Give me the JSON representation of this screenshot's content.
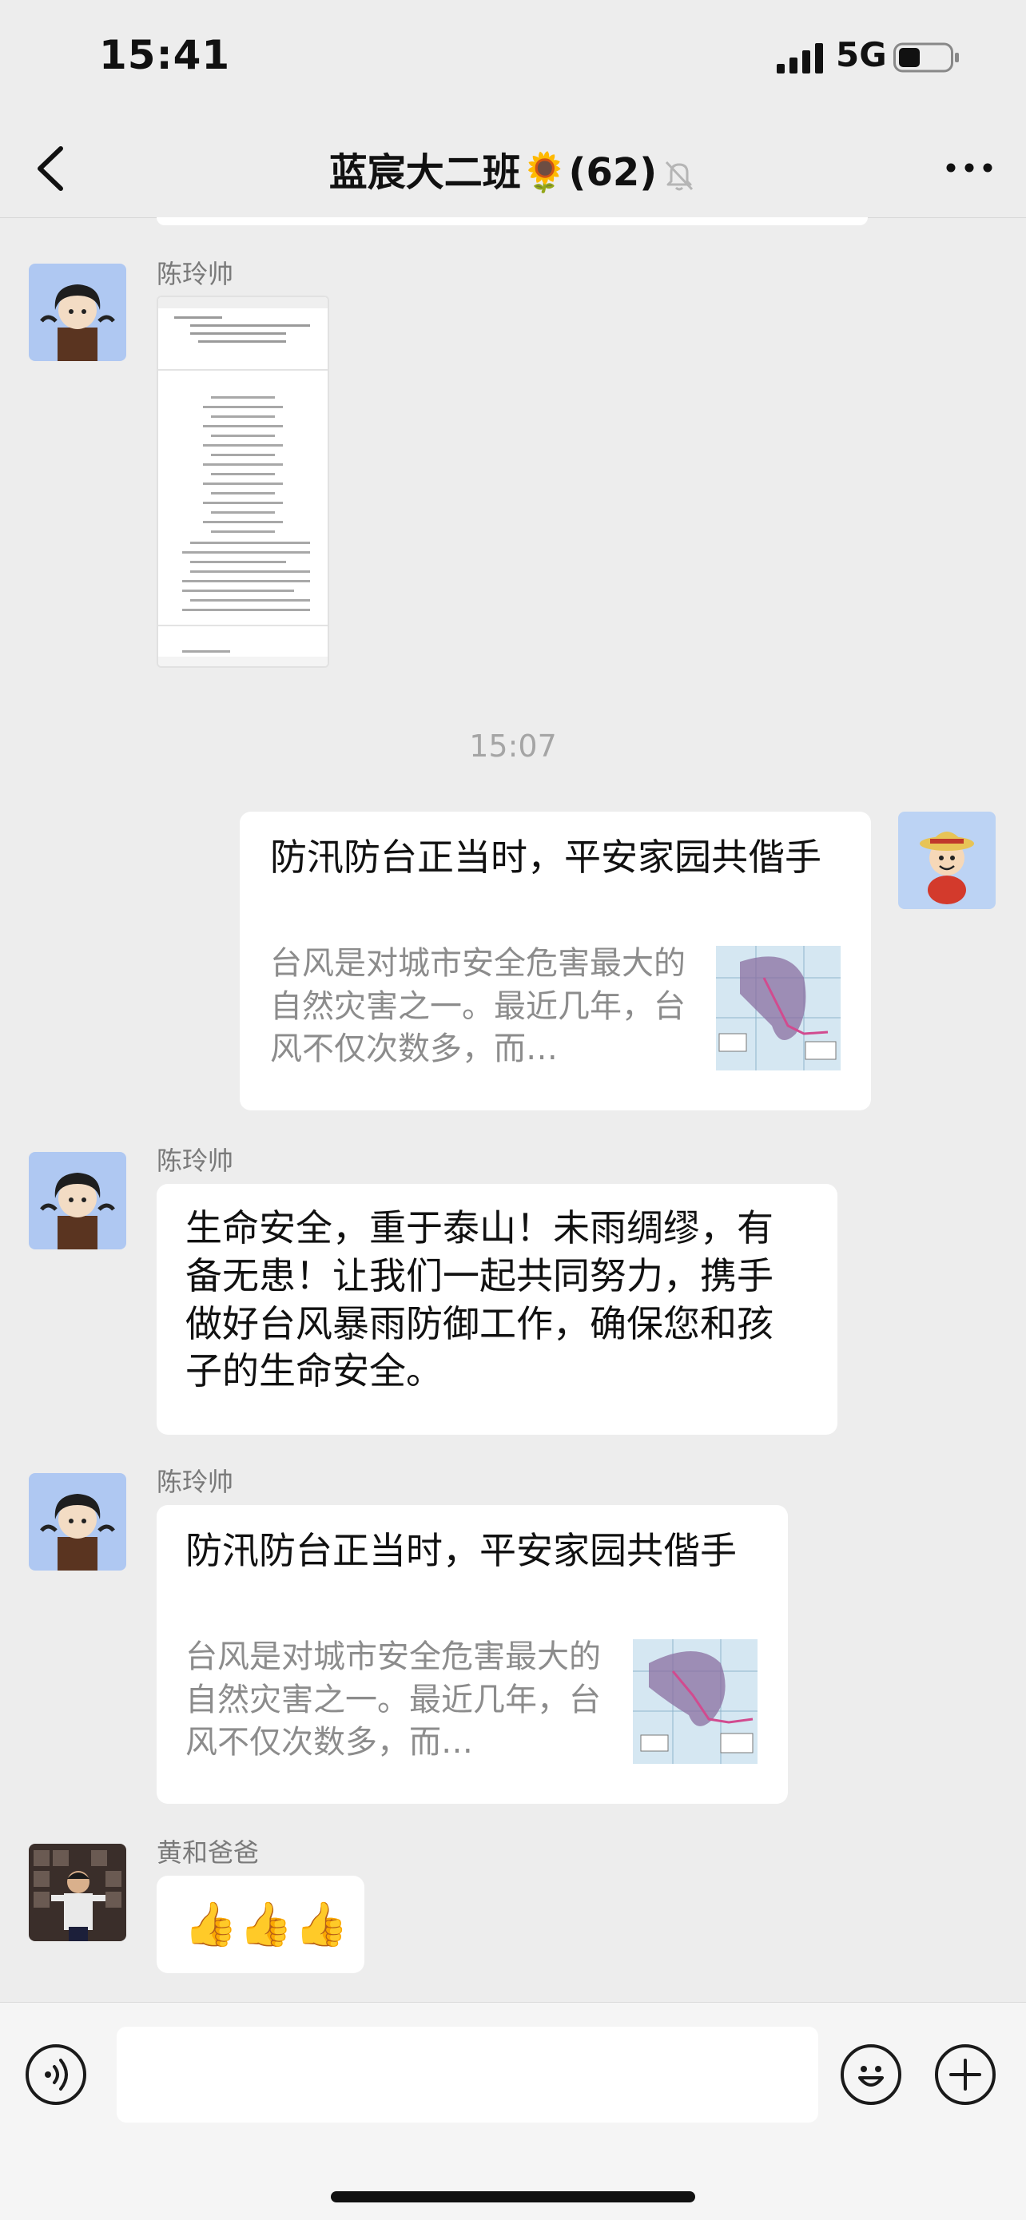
{
  "status_bar": {
    "time": "15:41",
    "network": "5G"
  },
  "nav": {
    "title": "蓝宸大二班🌻(62)"
  },
  "messages": {
    "m1": {
      "sender": "陈玲帅"
    },
    "timestamp": "15:07",
    "m2": {
      "title": "防汛防台正当时，平安家园共偕手",
      "desc": "台风是对城市安全危害最大的自然灾害之一。最近几年，台风不仅次数多，而…"
    },
    "m3": {
      "sender": "陈玲帅",
      "text": "生命安全，重于泰山！未雨绸缪，有备无患！让我们一起共同努力，携手做好台风暴雨防御工作，确保您和孩子的生命安全。"
    },
    "m4": {
      "sender": "陈玲帅",
      "title": "防汛防台正当时，平安家园共偕手",
      "desc": "台风是对城市安全危害最大的自然灾害之一。最近几年，台风不仅次数多，而…"
    },
    "m5": {
      "sender": "黄和爸爸",
      "text": "👍👍👍"
    }
  },
  "input": {
    "value": ""
  },
  "colors": {
    "background": "#EDEDED",
    "bubble": "#FFFFFF",
    "input_bar": "#F5F5F5"
  },
  "icons": [
    "back-arrow-icon",
    "mute-bell-icon",
    "more-icon",
    "voice-icon",
    "emoji-icon",
    "add-icon"
  ]
}
